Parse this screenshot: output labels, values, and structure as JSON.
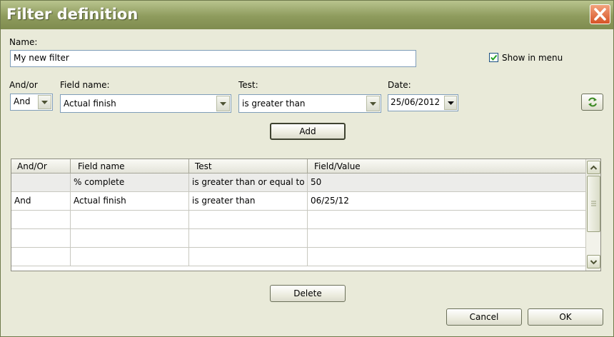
{
  "window": {
    "title": "Filter definition"
  },
  "name_label": "Name:",
  "name_value": "My new filter",
  "show_in_menu": {
    "label": "Show in menu",
    "checked": true
  },
  "andor_label": "And/or",
  "andor_value": "And",
  "field_label": "Field name:",
  "field_value": "Actual finish",
  "test_label": "Test:",
  "test_value": "is greater than",
  "date_label": "Date:",
  "date_value": "25/06/2012",
  "add_label": "Add",
  "table": {
    "headers": [
      "And/Or",
      "Field name",
      "Test",
      "Field/Value"
    ],
    "rows": [
      [
        "",
        "% complete",
        "is greater than or equal to",
        "50"
      ],
      [
        "And",
        "Actual finish",
        "is greater than",
        "06/25/12"
      ]
    ]
  },
  "delete_label": "Delete",
  "cancel_label": "Cancel",
  "ok_label": "OK",
  "colors": {
    "titlebar": "#8e9b5d",
    "window_bg": "#e9ead9",
    "close": "#d65326",
    "selected_row": "#ececea"
  }
}
